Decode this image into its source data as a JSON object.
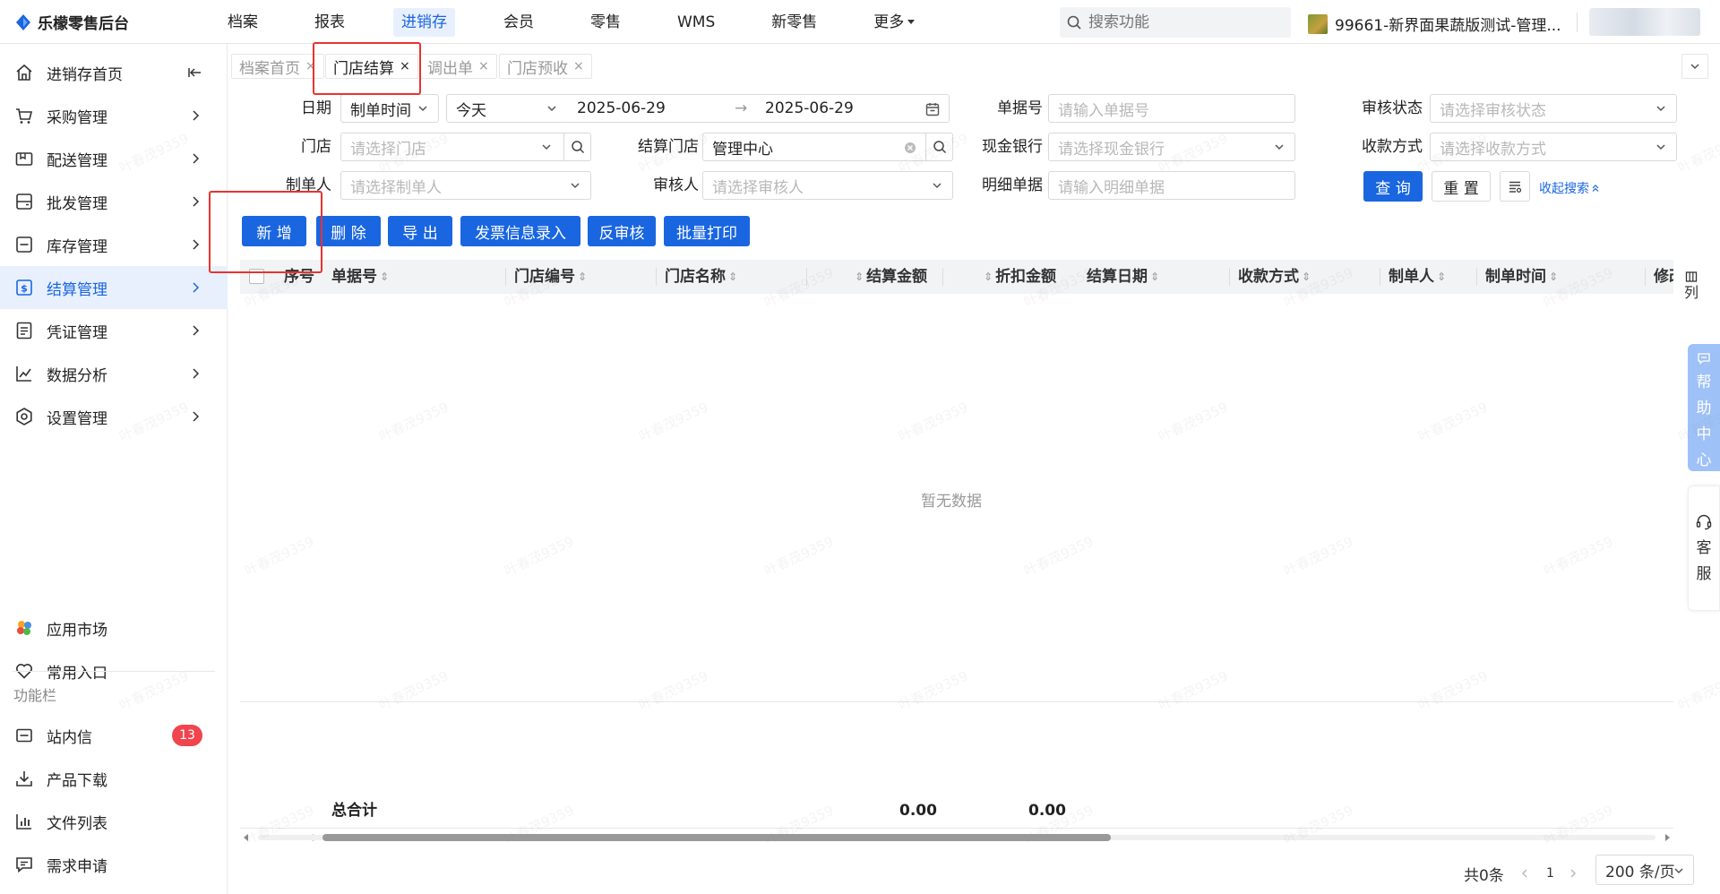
{
  "app": {
    "title": "乐檬零售后台"
  },
  "topnav": {
    "items": [
      {
        "label": "档案",
        "active": false
      },
      {
        "label": "报表",
        "active": false
      },
      {
        "label": "进销存",
        "active": true
      },
      {
        "label": "会员",
        "active": false
      },
      {
        "label": "零售",
        "active": false
      },
      {
        "label": "WMS",
        "active": false
      },
      {
        "label": "新零售",
        "active": false
      },
      {
        "label": "更多",
        "active": false
      }
    ]
  },
  "search": {
    "placeholder": "搜索功能"
  },
  "tenant": {
    "name": "99661-新界面果蔬版测试-管理..."
  },
  "sidebar": {
    "items": [
      {
        "label": "进销存首页",
        "icon": "home-icon"
      },
      {
        "label": "采购管理",
        "icon": "cart-icon"
      },
      {
        "label": "配送管理",
        "icon": "delivery-icon"
      },
      {
        "label": "批发管理",
        "icon": "wholesale-icon"
      },
      {
        "label": "库存管理",
        "icon": "inventory-icon"
      },
      {
        "label": "结算管理",
        "icon": "settlement-icon",
        "active": true
      },
      {
        "label": "凭证管理",
        "icon": "voucher-icon"
      },
      {
        "label": "数据分析",
        "icon": "analysis-icon"
      },
      {
        "label": "设置管理",
        "icon": "settings-icon"
      }
    ],
    "extras": [
      {
        "label": "应用市场",
        "icon": "app-market-icon"
      },
      {
        "label": "常用入口",
        "icon": "heart-icon"
      }
    ],
    "section_label": "功能栏",
    "tools": [
      {
        "label": "站内信",
        "icon": "mail-icon",
        "badge": "13"
      },
      {
        "label": "产品下载",
        "icon": "download-icon"
      },
      {
        "label": "文件列表",
        "icon": "file-list-icon"
      },
      {
        "label": "需求申请",
        "icon": "request-icon"
      }
    ]
  },
  "tabs": [
    {
      "label": "档案首页",
      "close": "×",
      "active": false
    },
    {
      "label": "门店结算",
      "close": "×",
      "active": true
    },
    {
      "label": "调出单",
      "close": "×",
      "active": false
    },
    {
      "label": "门店预收",
      "close": "×",
      "active": false
    }
  ],
  "filters": {
    "date_label": "日期",
    "date_type": "制单时间",
    "date_range": "今天",
    "date_start": "2025-06-29",
    "date_arrow": "→",
    "date_end": "2025-06-29",
    "store_label": "门店",
    "store_placeholder": "请选择门店",
    "settle_store_label": "结算门店",
    "settle_store_value": "管理中心",
    "creator_label": "制单人",
    "creator_placeholder": "请选择制单人",
    "auditor_label": "审核人",
    "auditor_placeholder": "请选择审核人",
    "doc_no_label": "单据号",
    "doc_no_placeholder": "请输入单据号",
    "cash_bank_label": "现金银行",
    "cash_bank_placeholder": "请选择现金银行",
    "detail_doc_label": "明细单据",
    "detail_doc_placeholder": "请输入明细单据",
    "audit_status_label": "审核状态",
    "audit_status_placeholder": "请选择审核状态",
    "payment_method_label": "收款方式",
    "payment_method_placeholder": "请选择收款方式"
  },
  "filter_actions": {
    "query": "查 询",
    "reset": "重 置",
    "collapse": "收起搜索"
  },
  "actions": {
    "add": "新 增",
    "delete": "删 除",
    "export": "导 出",
    "invoice": "发票信息录入",
    "unaudit": "反审核",
    "batch_print": "批量打印"
  },
  "table": {
    "columns": [
      "序号",
      "单据号",
      "门店编号",
      "门店名称",
      "结算金额",
      "折扣金额",
      "结算日期",
      "收款方式",
      "制单人",
      "制单时间",
      "修改"
    ],
    "empty_text": "暂无数据",
    "total_label": "总合计",
    "total_settle": "0.00",
    "total_discount": "0.00",
    "column_settings": "列"
  },
  "pagination": {
    "total": "共0条",
    "current": "1",
    "page_size": "200 条/页"
  },
  "float": {
    "help": [
      "帮",
      "助",
      "中",
      "心"
    ],
    "service": [
      "客",
      "服"
    ]
  },
  "watermark": "叶春茂9359",
  "colors": {
    "primary": "#1a66e0",
    "highlight": "#e8332f",
    "badge": "#f0454e",
    "sidebar_active_bg": "#e8f0fe"
  }
}
